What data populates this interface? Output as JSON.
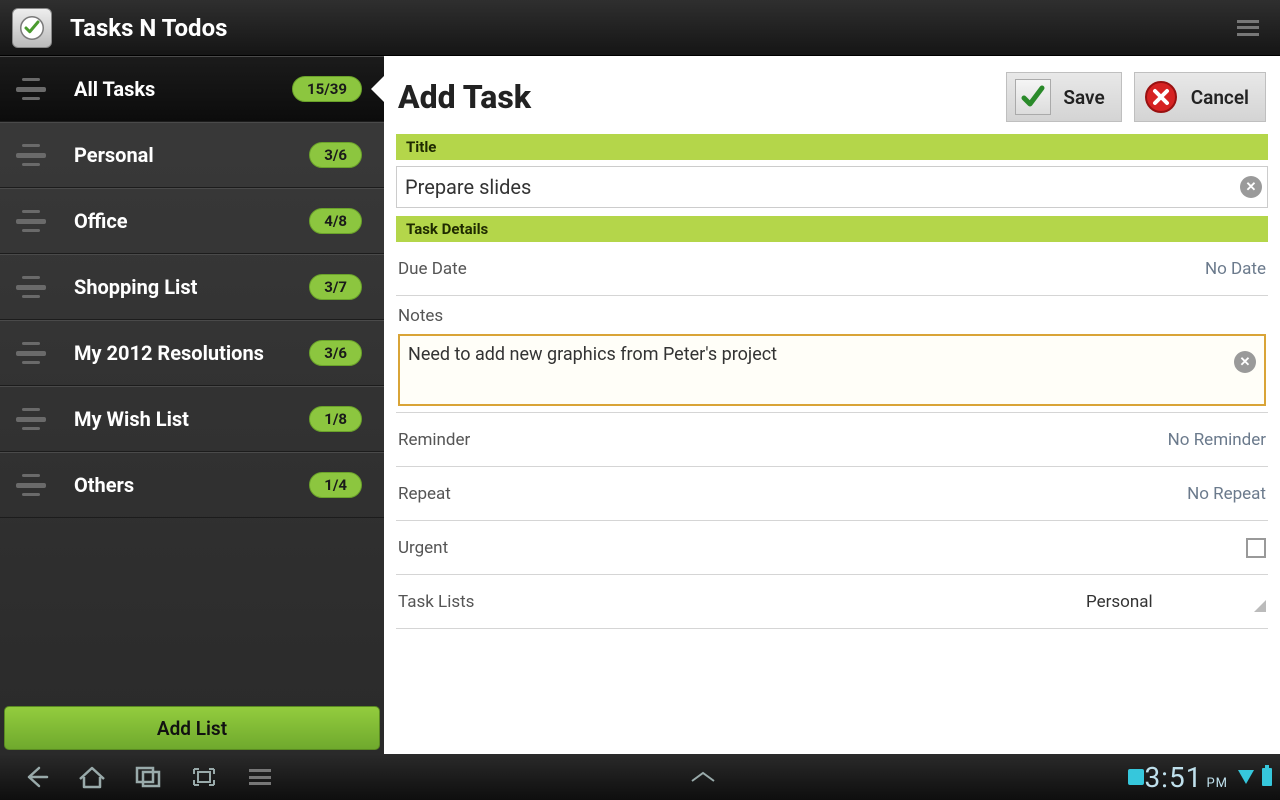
{
  "app": {
    "title": "Tasks N Todos"
  },
  "sidebar": {
    "items": [
      {
        "label": "All Tasks",
        "badge": "15/39",
        "active": true
      },
      {
        "label": "Personal",
        "badge": "3/6"
      },
      {
        "label": "Office",
        "badge": "4/8"
      },
      {
        "label": "Shopping List",
        "badge": "3/7"
      },
      {
        "label": "My 2012 Resolutions",
        "badge": "3/6"
      },
      {
        "label": "My Wish List",
        "badge": "1/8"
      },
      {
        "label": "Others",
        "badge": "1/4"
      }
    ],
    "add_list_label": "Add List"
  },
  "panel": {
    "heading": "Add Task",
    "save_label": "Save",
    "cancel_label": "Cancel",
    "section_title": "Title",
    "title_value": "Prepare slides",
    "section_details": "Task Details",
    "rows": {
      "due_date_label": "Due Date",
      "due_date_value": "No Date",
      "notes_label": "Notes",
      "notes_value": "Need to add new graphics from Peter's project",
      "reminder_label": "Reminder",
      "reminder_value": "No Reminder",
      "repeat_label": "Repeat",
      "repeat_value": "No Repeat",
      "urgent_label": "Urgent",
      "tasklists_label": "Task Lists",
      "tasklists_value": "Personal"
    }
  },
  "statusbar": {
    "time": "3:51",
    "ampm": "PM"
  }
}
